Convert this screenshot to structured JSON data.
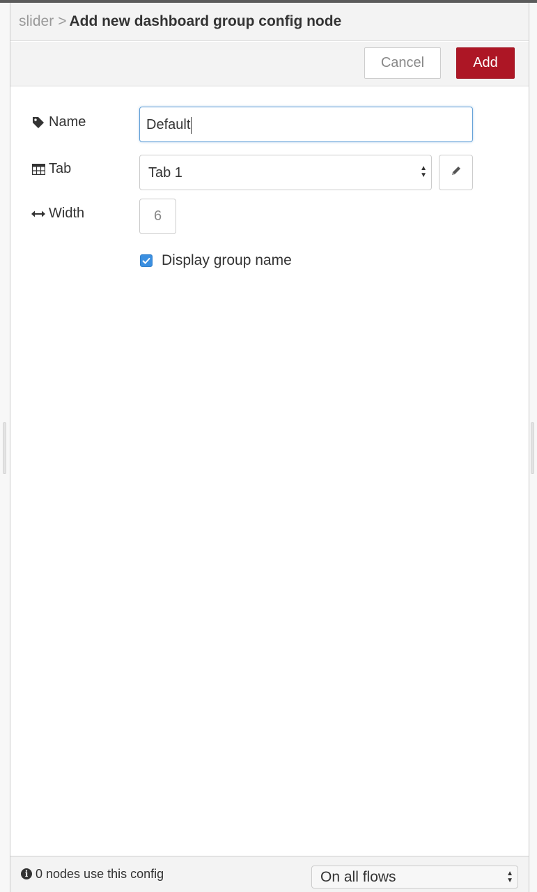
{
  "header": {
    "breadcrumb_parent": "slider",
    "separator": ">",
    "title": "Add new dashboard group config node"
  },
  "toolbar": {
    "cancel_label": "Cancel",
    "add_label": "Add"
  },
  "form": {
    "name": {
      "label": "Name",
      "icon": "tag-icon",
      "value": "Default"
    },
    "tab": {
      "label": "Tab",
      "icon": "table-icon",
      "selected": "Tab 1",
      "edit_icon": "pencil-icon"
    },
    "width": {
      "label": "Width",
      "icon": "arrows-horizontal-icon",
      "value": "6"
    },
    "display_group_name": {
      "label": "Display group name",
      "checked": true
    }
  },
  "footer": {
    "usage_text": "0 nodes use this config",
    "scope_selected": "On all flows"
  },
  "colors": {
    "accent": "#ad1625",
    "focus_border": "#64a1d8",
    "checkbox": "#3b8fe0"
  }
}
